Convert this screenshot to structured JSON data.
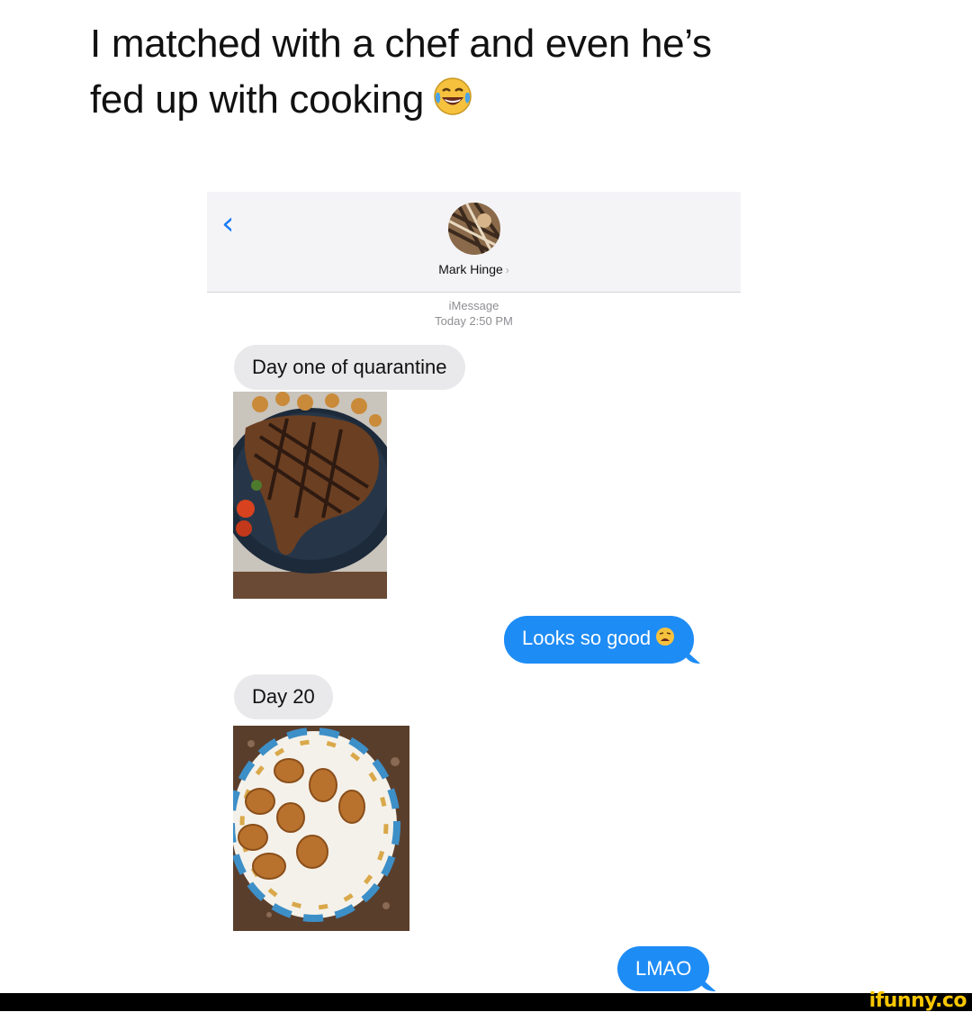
{
  "caption": {
    "line1": "I matched with a chef and even he’s",
    "line2": "fed up with cooking"
  },
  "header": {
    "back_icon": "chevron-left-icon",
    "contact_name": "Mark Hinge",
    "contact_chevron": "›"
  },
  "meta": {
    "service": "iMessage",
    "timestamp": "Today 2:50 PM"
  },
  "messages": [
    {
      "from": "them",
      "text": "Day one of quarantine"
    },
    {
      "from": "them",
      "type": "photo",
      "photo": "steak-photo"
    },
    {
      "from": "me",
      "text": "Looks so good"
    },
    {
      "from": "them",
      "text": "Day 20"
    },
    {
      "from": "them",
      "type": "photo",
      "photo": "chicken-nuggets-photo"
    },
    {
      "from": "me",
      "text": "LMAO"
    }
  ],
  "watermark": "ifunny.co",
  "colors": {
    "outgoing_bubble": "#1e8cf5",
    "incoming_bubble": "#e9e9eb",
    "accent": "#1a7cf5",
    "watermark": "#f7c600"
  }
}
